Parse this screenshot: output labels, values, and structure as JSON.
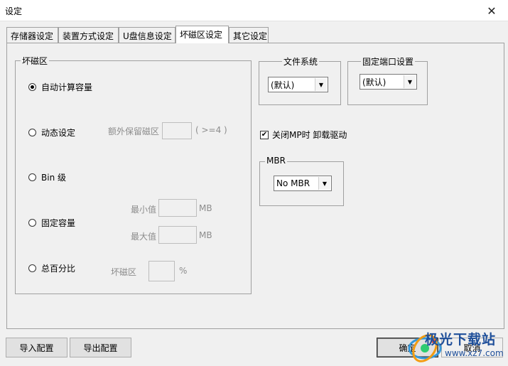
{
  "window": {
    "title": "设定",
    "close_glyph": "✕"
  },
  "tabs": [
    {
      "label": "存储器设定",
      "active": false
    },
    {
      "label": "装置方式设定",
      "active": false
    },
    {
      "label": "U盘信息设定",
      "active": false
    },
    {
      "label": "坏磁区设定",
      "active": true
    },
    {
      "label": "其它设定",
      "active": false
    }
  ],
  "bad_sector_group": {
    "label": "坏磁区",
    "options": {
      "auto": {
        "label": "自动计算容量",
        "selected": true
      },
      "dynamic": {
        "label": "动态设定",
        "selected": false,
        "extra_label": "额外保留磁区",
        "value": "",
        "hint": "( >=4 )"
      },
      "bin": {
        "label": "Bin 级",
        "selected": false
      },
      "fixed": {
        "label": "固定容量",
        "selected": false,
        "min_label": "最小值",
        "min_value": "",
        "max_label": "最大值",
        "max_value": "",
        "unit": "MB"
      },
      "percent": {
        "label": "总百分比",
        "selected": false,
        "field_label": "坏磁区",
        "value": "",
        "unit": "%"
      }
    }
  },
  "filesystem": {
    "label": "文件系统",
    "selected": "(默认)"
  },
  "fixed_port": {
    "label": "固定端口设置",
    "selected": "(默认)"
  },
  "close_mp_unload_driver": {
    "label": "关闭MP时 卸载驱动",
    "checked": true,
    "check_glyph": "✔"
  },
  "mbr": {
    "label": "MBR",
    "selected": "No MBR"
  },
  "combo_arrow": "▼",
  "buttons": {
    "import": "导入配置",
    "export": "导出配置",
    "ok": "确定",
    "cancel": "取消"
  },
  "watermark": {
    "brand": "极光下载站",
    "url": "www.xz7.com",
    "colors": [
      "#1f4f9a",
      "#f39c12",
      "#2ecc71",
      "#e74c3c",
      "#3498db"
    ]
  }
}
